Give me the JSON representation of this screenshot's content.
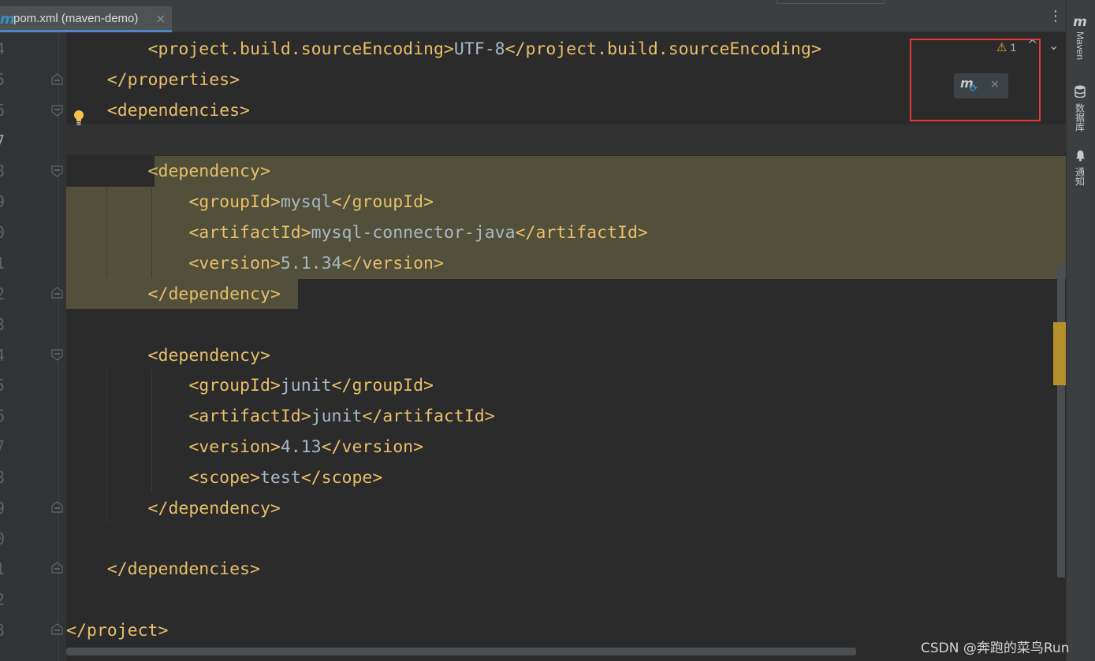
{
  "tab": {
    "icon": "m",
    "title": "pom.xml (maven-demo)",
    "close": "×"
  },
  "tab_menu": "⋮",
  "inspection": {
    "icon": "⚠",
    "count": "1",
    "up": "^",
    "down": "⌄"
  },
  "maven_popup": {
    "icon": "m",
    "reload_icon": "⟳",
    "close": "×"
  },
  "gutter": {
    "line_numbers": [
      "4",
      "5",
      "6",
      "7",
      "8",
      "9",
      "0",
      "1",
      "2",
      "3",
      "4",
      "5",
      "6",
      "7",
      "8",
      "9",
      "0",
      "1",
      "2",
      "3"
    ],
    "current_line_index": 3
  },
  "code": [
    {
      "parts": [
        [
          "t",
          "        <project.build.sourceEncoding>"
        ],
        [
          "x",
          "UTF-8"
        ],
        [
          "t",
          "</project.build.sourceEncoding>"
        ]
      ]
    },
    {
      "parts": [
        [
          "t",
          "    </properties>"
        ]
      ]
    },
    {
      "parts": [
        [
          "t",
          "    <dependencies>"
        ]
      ]
    },
    {
      "parts": [
        [
          "t",
          ""
        ]
      ]
    },
    {
      "parts": [
        [
          "t",
          "        <dependency>"
        ]
      ]
    },
    {
      "parts": [
        [
          "t",
          "            <groupId>"
        ],
        [
          "x",
          "mysql"
        ],
        [
          "t",
          "</groupId>"
        ]
      ]
    },
    {
      "parts": [
        [
          "t",
          "            <artifactId>"
        ],
        [
          "x",
          "mysql-connector-java"
        ],
        [
          "t",
          "</artifactId>"
        ]
      ]
    },
    {
      "parts": [
        [
          "t",
          "            <version>"
        ],
        [
          "x",
          "5.1.34"
        ],
        [
          "t",
          "</version>"
        ]
      ]
    },
    {
      "parts": [
        [
          "t",
          "        </dependency>"
        ]
      ]
    },
    {
      "parts": [
        [
          "t",
          ""
        ]
      ]
    },
    {
      "parts": [
        [
          "t",
          "        <dependency>"
        ]
      ]
    },
    {
      "parts": [
        [
          "t",
          "            <groupId>"
        ],
        [
          "x",
          "junit"
        ],
        [
          "t",
          "</groupId>"
        ]
      ]
    },
    {
      "parts": [
        [
          "t",
          "            <artifactId>"
        ],
        [
          "x",
          "junit"
        ],
        [
          "t",
          "</artifactId>"
        ]
      ]
    },
    {
      "parts": [
        [
          "t",
          "            <version>"
        ],
        [
          "x",
          "4.13"
        ],
        [
          "t",
          "</version>"
        ]
      ]
    },
    {
      "parts": [
        [
          "t",
          "            <scope>"
        ],
        [
          "x",
          "test"
        ],
        [
          "t",
          "</scope>"
        ]
      ]
    },
    {
      "parts": [
        [
          "t",
          "        </dependency>"
        ]
      ]
    },
    {
      "parts": [
        [
          "t",
          ""
        ]
      ]
    },
    {
      "parts": [
        [
          "t",
          "    </dependencies>"
        ]
      ]
    },
    {
      "parts": [
        [
          "t",
          ""
        ]
      ]
    },
    {
      "parts": [
        [
          "t",
          "</project>"
        ]
      ]
    }
  ],
  "tool_windows": {
    "maven": {
      "icon": "m",
      "label": "Maven"
    },
    "database": {
      "icon": "database-icon",
      "label": "数据库"
    },
    "notifications": {
      "icon": "bell-icon",
      "label": "通知"
    }
  },
  "watermark": "CSDN @奔跑的菜鸟Run",
  "colors": {
    "tag": "#e8bf6a",
    "text": "#a9b7c6",
    "highlight": "#52503a",
    "accent": "#3592c4",
    "annotation": "#e53935"
  }
}
